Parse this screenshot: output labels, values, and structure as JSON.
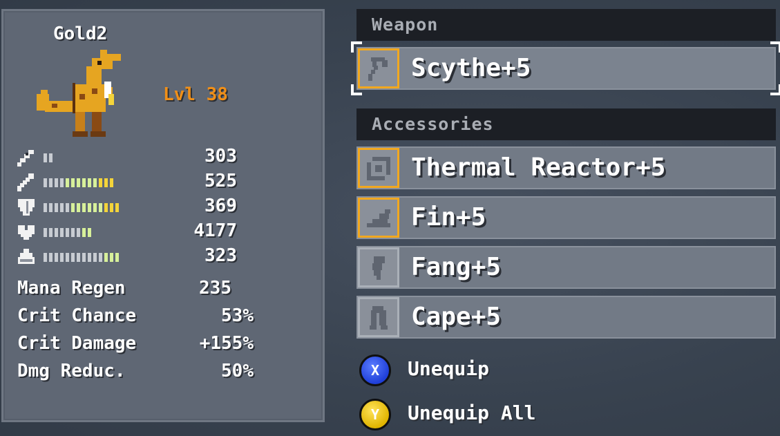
{
  "character": {
    "name": "Gold2",
    "level": "Lvl 38"
  },
  "stats": [
    {
      "icon": "sword-icon",
      "value": "303",
      "bar_segments": 2,
      "yellow_segments": 0,
      "lightgreen_segments": 0
    },
    {
      "icon": "wand-icon",
      "value": "525",
      "bar_segments": 13,
      "yellow_segments": 3,
      "lightgreen_segments": 6
    },
    {
      "icon": "shield-icon",
      "value": "369",
      "bar_segments": 14,
      "yellow_segments": 3,
      "lightgreen_segments": 6
    },
    {
      "icon": "heart-icon",
      "value": "4177",
      "bar_segments": 9,
      "yellow_segments": 0,
      "lightgreen_segments": 2
    },
    {
      "icon": "potion-icon",
      "value": "323",
      "bar_segments": 14,
      "yellow_segments": 0,
      "lightgreen_segments": 3
    }
  ],
  "extra_stats": [
    {
      "label": "Mana Regen",
      "value": "235"
    },
    {
      "label": "Crit Chance",
      "value": "53%"
    },
    {
      "label": "Crit Damage",
      "value": "+155%"
    },
    {
      "label": "Dmg Reduc.",
      "value": "50%"
    }
  ],
  "weapon": {
    "header": "Weapon",
    "slot": {
      "label": "Scythe+5",
      "icon": "scythe-icon",
      "equipped": true
    }
  },
  "accessories": {
    "header": "Accessories",
    "slots": [
      {
        "label": "Thermal Reactor+5",
        "icon": "reactor-icon",
        "equipped": true
      },
      {
        "label": "Fin+5",
        "icon": "fin-icon",
        "equipped": true
      },
      {
        "label": "Fang+5",
        "icon": "fang-icon",
        "equipped": false
      },
      {
        "label": "Cape+5",
        "icon": "cape-icon",
        "equipped": false
      }
    ]
  },
  "actions": [
    {
      "button": "X",
      "label": "Unequip",
      "color": "#2a4ae8"
    },
    {
      "button": "Y",
      "label": "Unequip All",
      "color": "#f0c400"
    }
  ],
  "colors": {
    "level": "#f08f18",
    "equipped_border": "#f2a81f",
    "header_bg": "#1c1f25"
  }
}
